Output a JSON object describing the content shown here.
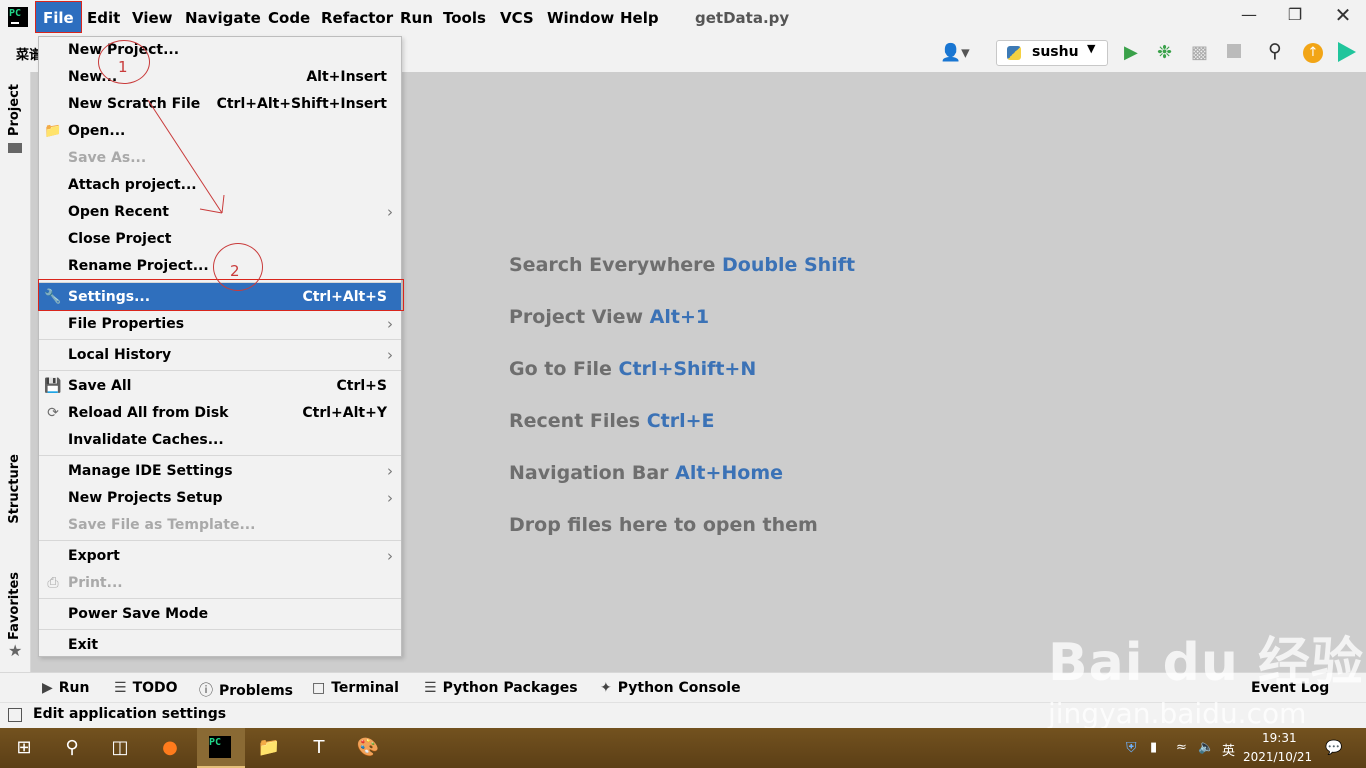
{
  "menubar": {
    "items": [
      "File",
      "Edit",
      "View",
      "Navigate",
      "Code",
      "Refactor",
      "Run",
      "Tools",
      "VCS",
      "Window",
      "Help"
    ],
    "window_title": "getData.py"
  },
  "toolbar": {
    "breadcrumb_fragment": "菜谱",
    "run_config": "sushu"
  },
  "file_menu": {
    "new_project": "New Project...",
    "new": "New...",
    "new_sc": "Alt+Insert",
    "new_scratch": "New Scratch File",
    "new_scratch_sc": "Ctrl+Alt+Shift+Insert",
    "open": "Open...",
    "save_as": "Save As...",
    "attach": "Attach project...",
    "open_recent": "Open Recent",
    "close_project": "Close Project",
    "rename_project": "Rename Project...",
    "settings": "Settings...",
    "settings_sc": "Ctrl+Alt+S",
    "file_properties": "File Properties",
    "local_history": "Local History",
    "save_all": "Save All",
    "save_all_sc": "Ctrl+S",
    "reload": "Reload All from Disk",
    "reload_sc": "Ctrl+Alt+Y",
    "invalidate": "Invalidate Caches...",
    "manage_ide": "Manage IDE Settings",
    "new_projects_setup": "New Projects Setup",
    "save_template": "Save File as Template...",
    "export": "Export",
    "print": "Print...",
    "power_save": "Power Save Mode",
    "exit": "Exit"
  },
  "left_tabs": {
    "project": "Project",
    "structure": "Structure",
    "favorites": "Favorites"
  },
  "editor_hints": [
    {
      "text": "Search Everywhere",
      "key": "Double Shift"
    },
    {
      "text": "Project View",
      "key": "Alt+1"
    },
    {
      "text": "Go to File",
      "key": "Ctrl+Shift+N"
    },
    {
      "text": "Recent Files",
      "key": "Ctrl+E"
    },
    {
      "text": "Navigation Bar",
      "key": "Alt+Home"
    },
    {
      "text": "Drop files here to open them",
      "key": ""
    }
  ],
  "bottom_tabs": {
    "run": "Run",
    "todo": "TODO",
    "problems": "Problems",
    "terminal": "Terminal",
    "packages": "Python Packages",
    "console": "Python Console",
    "event_log": "Event Log"
  },
  "status": "Edit application settings",
  "annotations": {
    "one": "1",
    "two": "2"
  },
  "watermark": {
    "logo": "Bai du 经验",
    "url": "jingyan.baidu.com"
  },
  "taskbar": {
    "time": "19:31",
    "date": "2021/10/21",
    "ime": "英"
  }
}
